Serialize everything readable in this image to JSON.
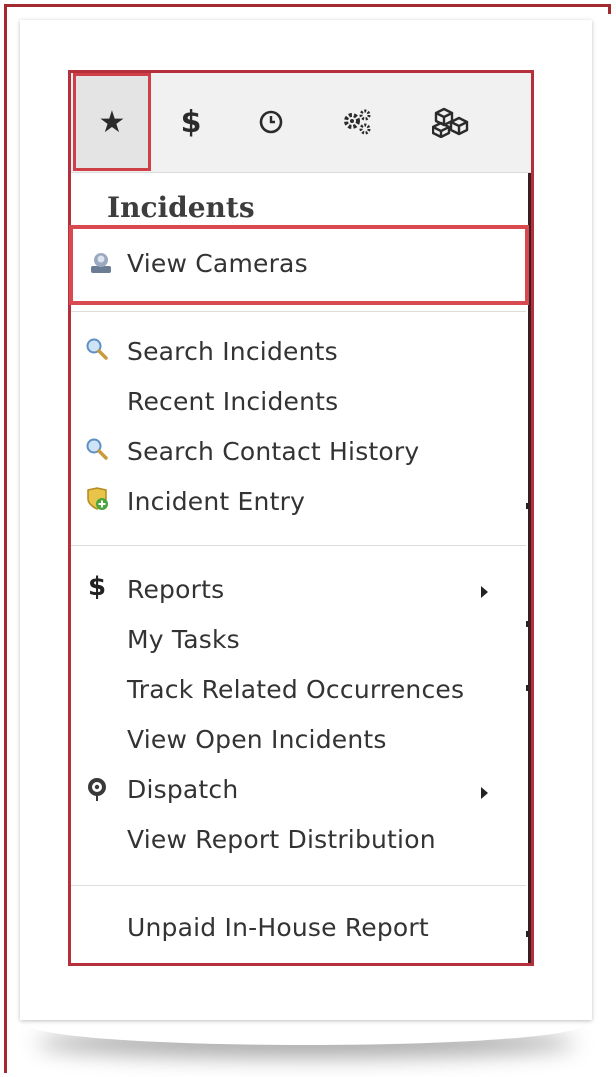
{
  "toolbar": {
    "tabs": [
      {
        "icon": "star-icon",
        "glyph": "★",
        "active": true
      },
      {
        "icon": "dollar-icon",
        "glyph": "$",
        "active": false
      },
      {
        "icon": "clock-icon",
        "glyph": "clock",
        "active": false
      },
      {
        "icon": "gears-icon",
        "glyph": "gears",
        "active": false
      },
      {
        "icon": "cubes-icon",
        "glyph": "cubes",
        "active": false
      }
    ]
  },
  "section": {
    "title": "Incidents"
  },
  "menu": {
    "group1": [
      {
        "label": "View Cameras",
        "icon": "camera-user-icon"
      }
    ],
    "group2": [
      {
        "label": "Search Incidents",
        "icon": "magnifier-icon"
      },
      {
        "label": "Recent Incidents"
      },
      {
        "label": "Search Contact History",
        "icon": "magnifier-icon"
      },
      {
        "label": "Incident Entry",
        "icon": "shield-add-icon"
      }
    ],
    "group3": [
      {
        "label": "Reports",
        "icon": "dollar-icon",
        "submenu": true
      },
      {
        "label": "My Tasks"
      },
      {
        "label": "Track Related Occurrences"
      },
      {
        "label": "View Open Incidents"
      },
      {
        "label": "Dispatch",
        "icon": "radio-icon",
        "submenu": true
      },
      {
        "label": "View Report Distribution"
      }
    ],
    "group4": [
      {
        "label": "Unpaid In-House Report"
      }
    ]
  },
  "colors": {
    "highlight": "#d84a4f",
    "frame": "#a32a2f",
    "text": "#333333"
  }
}
